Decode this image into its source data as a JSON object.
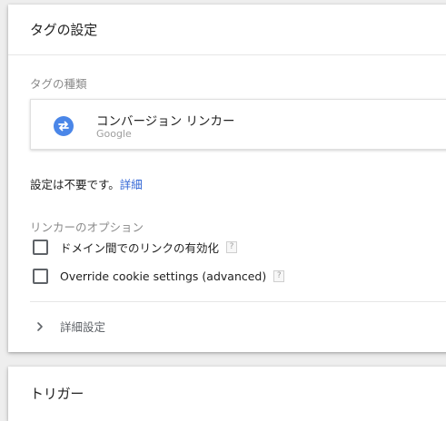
{
  "tag_config": {
    "title": "タグの設定",
    "tag_type_label": "タグの種類",
    "tag_type": {
      "name": "コンバージョン リンカー",
      "vendor": "Google",
      "icon": "swap-arrows-icon",
      "icon_color": "#4a86e8"
    },
    "not_required_text": "設定は不要です。",
    "details_link": "詳細",
    "linker_options_label": "リンカーのオプション",
    "options": [
      {
        "label": "ドメイン間でのリンクの有効化",
        "checked": false,
        "help": "?"
      },
      {
        "label": "Override cookie settings (advanced)",
        "checked": false,
        "help": "?"
      }
    ],
    "advanced_settings": "詳細設定"
  },
  "trigger": {
    "title": "トリガー"
  },
  "colors": {
    "link": "#3367d6",
    "background": "#eeeeee",
    "card": "#ffffff"
  }
}
